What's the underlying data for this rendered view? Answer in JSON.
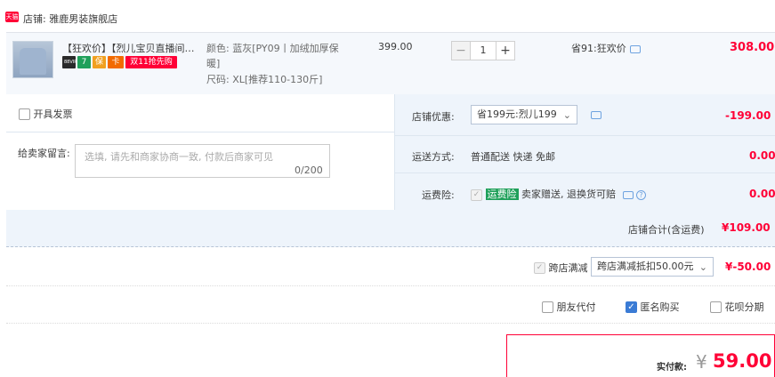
{
  "store": {
    "badge": "天猫",
    "label": "店铺: 雅鹿男装旗舰店"
  },
  "item": {
    "title": "【狂欢价】【烈儿宝贝直播间】...",
    "badges": [
      "88VIP",
      "7",
      "保",
      "卡",
      "双11抢先购"
    ],
    "color": "颜色: 蓝灰[PY09丨加绒加厚保",
    "color_cont": "暖]",
    "size": "尺码: XL[推荐110-130斤]",
    "price": "399.00",
    "quantity": "1",
    "minus": "−",
    "plus": "+",
    "saved": "省91:狂欢价",
    "subtotal": "308.00"
  },
  "invoice": {
    "label": "开具发票"
  },
  "memo": {
    "label": "给卖家留言:",
    "placeholder": "选填, 请先和商家协商一致, 付款后商家可见",
    "count": "0/200"
  },
  "shop_discount": {
    "label": "店铺优惠:",
    "selected": "省199元:烈儿199",
    "amount": "-199.00"
  },
  "shipping": {
    "label": "运送方式:",
    "value": "普通配送 快递 免邮",
    "amount": "0.00"
  },
  "insurance": {
    "label": "运费险:",
    "tag": "运费险",
    "text": "卖家赠送, 退换货可赔",
    "amount": "0.00"
  },
  "shop_total": {
    "label": "店铺合计(含运费)",
    "amount": "¥109.00"
  },
  "cross_store": {
    "label": "跨店满减",
    "selected": "跨店满减抵扣50.00元",
    "amount": "¥-50.00"
  },
  "options": {
    "friend_pay": "朋友代付",
    "anonymous": "匿名购买",
    "huabei": "花呗分期"
  },
  "pay": {
    "label": "实付款:",
    "currency": "¥",
    "amount": "59.00"
  },
  "colors": {
    "accent": "#ff0036",
    "band": "#eef4fb",
    "check": "#3a7bd5"
  }
}
